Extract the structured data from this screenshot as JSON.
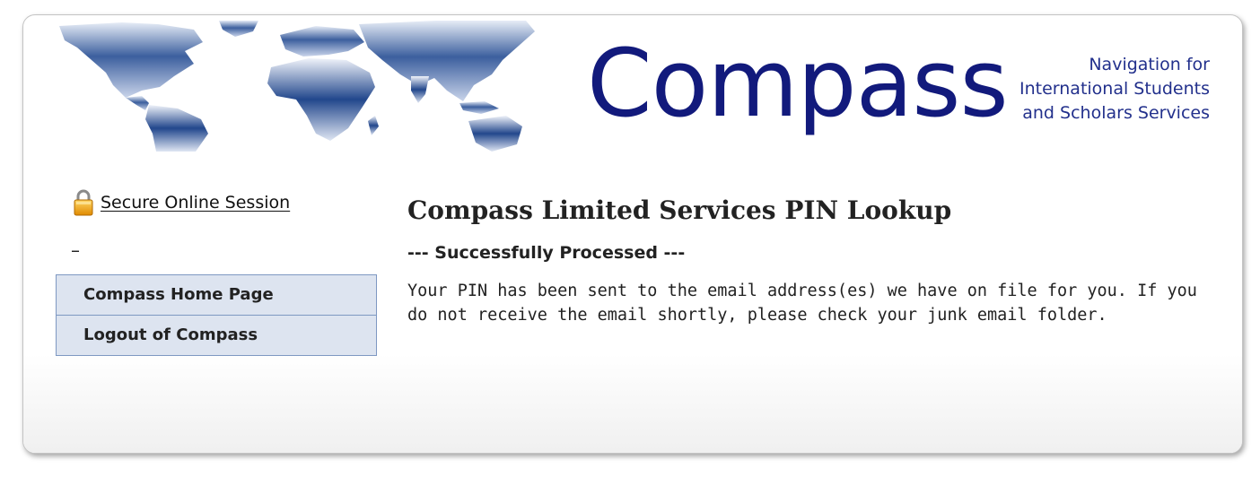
{
  "header": {
    "logo_text": "Compass",
    "tagline": [
      "Navigation for",
      "International Students",
      "and Scholars Services"
    ]
  },
  "sidebar": {
    "secure_session_label": "Secure Online Session",
    "separator": "–",
    "nav_items": [
      {
        "label": "Compass Home Page"
      },
      {
        "label": "Logout of Compass"
      }
    ]
  },
  "main": {
    "title": "Compass Limited Services PIN Lookup",
    "status": "--- Successfully Processed ---",
    "message": "Your PIN has been sent to the email address(es) we have on file for you. If you do not receive the email shortly, please check your junk email folder."
  },
  "colors": {
    "logo": "#121a7c",
    "nav_background": "#dde4f0",
    "nav_border": "#7e98c2"
  }
}
